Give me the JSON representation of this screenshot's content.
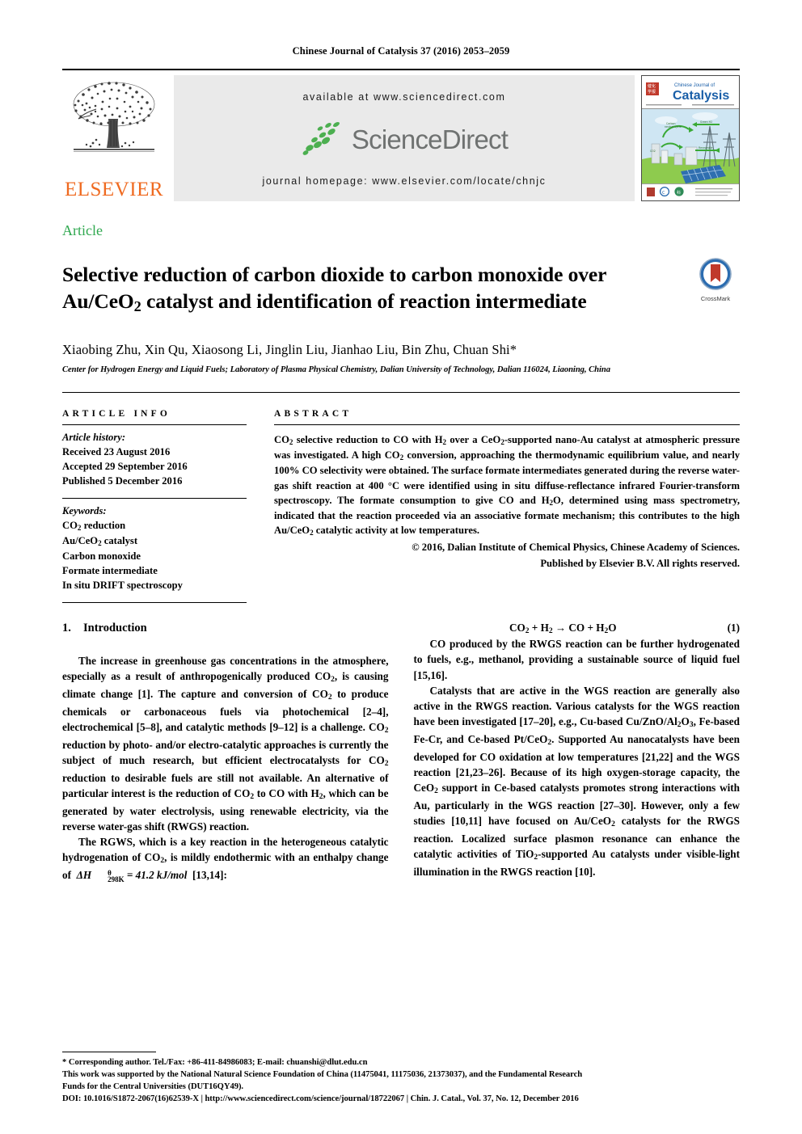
{
  "running_head": "Chinese Journal of Catalysis 37 (2016) 2053–2059",
  "masthead": {
    "publisher_wordmark": "ELSEVIER",
    "publisher_logo_name": "elsevier-tree-logo",
    "available_at": "available at www.sciencedirect.com",
    "sciencedirect_wordmark": "ScienceDirect",
    "journal_homepage": "journal homepage: www.elsevier.com/locate/chnjc",
    "cover": {
      "journal_title_line1": "Chinese Journal of",
      "journal_title_line2": "Catalysis",
      "caption": "Chinese Journal of Catalysis cover"
    }
  },
  "article": {
    "type_label": "Article",
    "title_line1": "Selective reduction of carbon dioxide to carbon monoxide over",
    "title_line2_a": "Au/CeO",
    "title_line2_sub": "2",
    "title_line2_b": " catalyst and identification of reaction intermediate",
    "crossmark_label": "CrossMark",
    "authors": "Xiaobing Zhu, Xin Qu, Xiaosong Li, Jinglin Liu, Jianhao Liu, Bin Zhu, Chuan Shi*",
    "affiliation": "Center for Hydrogen Energy and Liquid Fuels; Laboratory of Plasma Physical Chemistry, Dalian University of Technology, Dalian 116024, Liaoning, China"
  },
  "article_info": {
    "heading": "ARTICLE INFO",
    "history_label": "Article history:",
    "history": [
      "Received 23 August 2016",
      "Accepted 29 September 2016",
      "Published 5 December 2016"
    ],
    "keywords_label": "Keywords:",
    "keywords": [
      "CO2 reduction",
      "Au/CeO2 catalyst",
      "Carbon monoxide",
      "Formate intermediate",
      "In situ DRIFT spectroscopy"
    ]
  },
  "abstract": {
    "heading": "ABSTRACT",
    "body": "CO2 selective reduction to CO with H2 over a CeO2-supported nano-Au catalyst at atmospheric pressure was investigated. A high CO2 conversion, approaching the thermodynamic equilibrium value, and nearly 100% CO selectivity were obtained. The surface formate intermediates generated during the reverse water-gas shift reaction at 400 °C were identified using in situ diffuse-reflectance infrared Fourier-transform spectroscopy. The formate consumption to give CO and H2O, determined using mass spectrometry, indicated that the reaction proceeded via an associative formate mechanism; this contributes to the high Au/CeO2 catalytic activity at low temperatures.",
    "copyright_line1": "© 2016, Dalian Institute of Chemical Physics, Chinese Academy of Sciences.",
    "copyright_line2": "Published by Elsevier B.V. All rights reserved."
  },
  "sections": {
    "intro_number": "1.",
    "intro_title": "Introduction",
    "para1": "The increase in greenhouse gas concentrations in the atmosphere, especially as a result of anthropogenically produced CO2, is causing climate change [1]. The capture and conversion of CO2 to produce chemicals or carbonaceous fuels via photochemical [2–4], electrochemical [5–8], and catalytic methods [9–12] is a challenge. CO2 reduction by photo- and/or electro-catalytic approaches is currently the subject of much research, but efficient electrocatalysts for CO2 reduction to desirable fuels are still not available. An alternative of particular interest is the reduction of CO2 to CO with H2, which can be generated by water electrolysis, using renewable electricity, via the reverse water-gas shift (RWGS) reaction.",
    "para2_a": "The RGWS, which is a key reaction in the heterogeneous catalytic hydrogenation of CO2, is mildly endothermic with an enthalpy change of ",
    "para2_enthalpy_symbol": "ΔH",
    "para2_enthalpy_sup": "θ",
    "para2_enthalpy_sub": "298K",
    "para2_enthalpy_value": "= 41.2 kJ/mol",
    "para2_refs": "[13,14]:",
    "equation1": "CO2 + H2 → CO + H2O",
    "equation1_number": "(1)",
    "para3": "CO produced by the RWGS reaction can be further hydrogenated to fuels, e.g., methanol, providing a sustainable source of liquid fuel [15,16].",
    "para4": "Catalysts that are active in the WGS reaction are generally also active in the RWGS reaction. Various catalysts for the WGS reaction have been investigated [17–20], e.g., Cu-based Cu/ZnO/Al2O3, Fe-based Fe-Cr, and Ce-based Pt/CeO2. Supported Au nanocatalysts have been developed for CO oxidation at low temperatures [21,22] and the WGS reaction [21,23–26]. Because of its high oxygen-storage capacity, the CeO2 support in Ce-based catalysts promotes strong interactions with Au, particularly in the WGS reaction [27–30]. However, only a few studies [10,11] have focused on Au/CeO2 catalysts for the RWGS reaction. Localized surface plasmon resonance can enhance the catalytic activities of TiO2-supported Au catalysts under visible-light illumination in the RWGS reaction [10]."
  },
  "footnote": {
    "line1": "* Corresponding author. Tel./Fax: +86-411-84986083; E-mail: chuanshi@dlut.edu.cn",
    "line2": "This work was supported by the National Natural Science Foundation of China (11475041, 11175036, 21373037), and the Fundamental Research",
    "line3": "Funds for the Central Universities (DUT16QY49).",
    "line4": "DOI: 10.1016/S1872-2067(16)62539-X | http://www.sciencedirect.com/science/journal/18722067 | Chin. J. Catal., Vol. 37, No. 12, December 2016"
  },
  "colors": {
    "accent_green": "#2fa84f",
    "elsevier_orange": "#ef6a20",
    "sciencedirect_green": "#4caf50",
    "sciencedirect_gray": "#6f7271",
    "banner_gray": "#eaeaea",
    "crossmark_blue": "#2b6cb0",
    "crossmark_red": "#c0392b"
  }
}
